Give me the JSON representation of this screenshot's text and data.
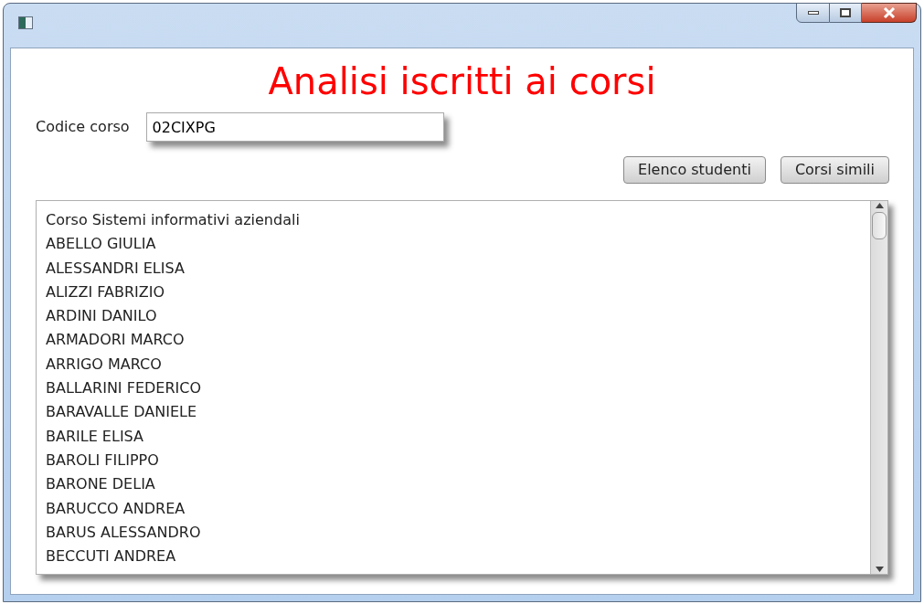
{
  "heading": "Analisi iscritti ai corsi",
  "course_code": {
    "label": "Codice corso",
    "value": "02CIXPG"
  },
  "buttons": [
    "Elenco studenti",
    "Corsi simili"
  ],
  "output": {
    "lines": [
      "Corso Sistemi informativi aziendali",
      "ABELLO GIULIA",
      "ALESSANDRI ELISA",
      "ALIZZI FABRIZIO",
      "ARDINI DANILO",
      "ARMADORI MARCO",
      "ARRIGO MARCO",
      "BALLARINI FEDERICO",
      "BARAVALLE DANIELE",
      "BARILE ELISA",
      "BAROLI FILIPPO",
      "BARONE DELIA",
      "BARUCCO ANDREA",
      "BARUS ALESSANDRO",
      "BECCUTI ANDREA"
    ]
  }
}
